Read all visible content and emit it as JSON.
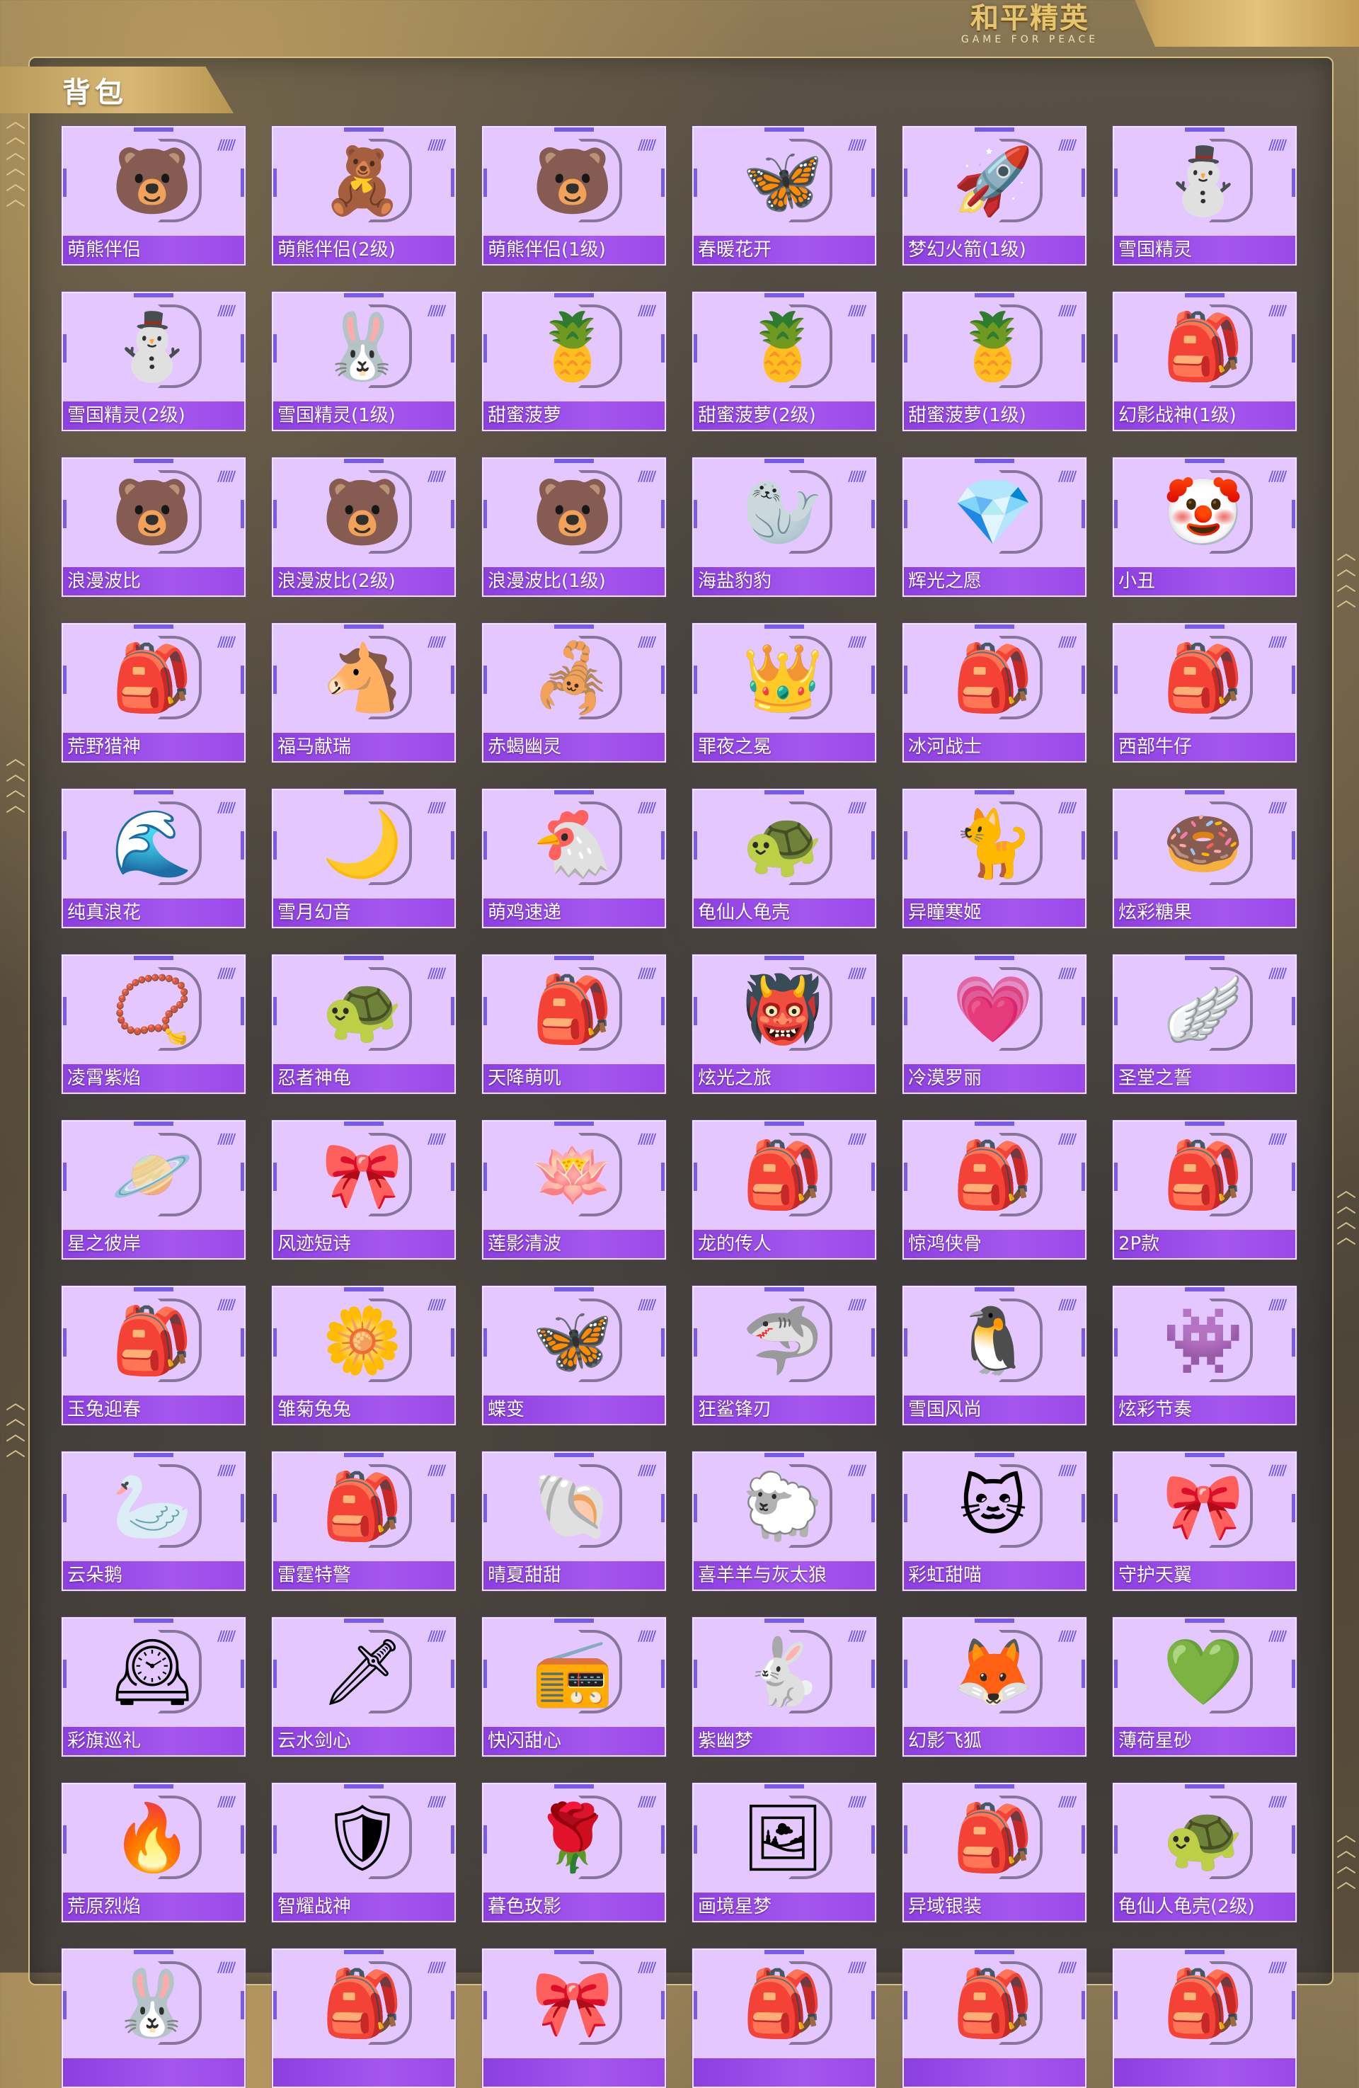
{
  "header": {
    "logo_cn": "和平精英",
    "logo_en": "GAME FOR PEACE"
  },
  "section": {
    "title": "背包"
  },
  "items": [
    {
      "name": "萌熊伴侣",
      "icon": "pink-bear-backpack-icon",
      "glyph": "🐻",
      "color": "#f3a2c6"
    },
    {
      "name": "萌熊伴侣(2级)",
      "icon": "pink-bear-backpack-icon",
      "glyph": "🧸",
      "color": "#f6a4bf"
    },
    {
      "name": "萌熊伴侣(1级)",
      "icon": "pink-bear-backpack-icon",
      "glyph": "🐻",
      "color": "#f4b0c8"
    },
    {
      "name": "春暖花开",
      "icon": "butterfly-backpack-icon",
      "glyph": "🦋",
      "color": "#7fd2f0"
    },
    {
      "name": "梦幻火箭(1级)",
      "icon": "rocket-backpack-icon",
      "glyph": "🚀",
      "color": "#3b3560"
    },
    {
      "name": "雪国精灵",
      "icon": "snowman-backpack-icon",
      "glyph": "⛄",
      "color": "#ffffff"
    },
    {
      "name": "雪国精灵(2级)",
      "icon": "snowman-backpack-icon",
      "glyph": "⛄",
      "color": "#ffffff"
    },
    {
      "name": "雪国精灵(1级)",
      "icon": "snow-bunny-backpack-icon",
      "glyph": "🐰",
      "color": "#ffffff"
    },
    {
      "name": "甜蜜菠萝",
      "icon": "pineapple-backpack-icon",
      "glyph": "🍍",
      "color": "#f5cf2e"
    },
    {
      "name": "甜蜜菠萝(2级)",
      "icon": "pineapple-backpack-icon",
      "glyph": "🍍",
      "color": "#f2c52a"
    },
    {
      "name": "甜蜜菠萝(1级)",
      "icon": "pineapple-backpack-icon",
      "glyph": "🍍",
      "color": "#f1c02a"
    },
    {
      "name": "幻影战神(1级)",
      "icon": "tactical-backpack-icon",
      "glyph": "🎒",
      "color": "#454f6a"
    },
    {
      "name": "浪漫波比",
      "icon": "bear-backpack-icon",
      "glyph": "🐻",
      "color": "#a57a45"
    },
    {
      "name": "浪漫波比(2级)",
      "icon": "bear-backpack-icon",
      "glyph": "🐻",
      "color": "#b18650"
    },
    {
      "name": "浪漫波比(1级)",
      "icon": "bear-backpack-icon",
      "glyph": "🐻",
      "color": "#b8894e"
    },
    {
      "name": "海盐豹豹",
      "icon": "seal-backpack-icon",
      "glyph": "🦭",
      "color": "#bfe9f5"
    },
    {
      "name": "辉光之愿",
      "icon": "crystal-heart-backpack-icon",
      "glyph": "💎",
      "color": "#c7c3d8"
    },
    {
      "name": "小丑",
      "icon": "jester-backpack-icon",
      "glyph": "🤡",
      "color": "#8e2fd0"
    },
    {
      "name": "荒野猎神",
      "icon": "hiking-backpack-icon",
      "glyph": "🎒",
      "color": "#4a3a33"
    },
    {
      "name": "福马献瑞",
      "icon": "horse-backpack-icon",
      "glyph": "🐴",
      "color": "#f07a3a"
    },
    {
      "name": "赤蝎幽灵",
      "icon": "scorpion-backpack-icon",
      "glyph": "🦂",
      "color": "#2f2a2e"
    },
    {
      "name": "罪夜之冕",
      "icon": "crown-backpack-icon",
      "glyph": "👑",
      "color": "#3a1f2f"
    },
    {
      "name": "冰河战士",
      "icon": "blue-backpack-icon",
      "glyph": "🎒",
      "color": "#3a6cc4"
    },
    {
      "name": "西部牛仔",
      "icon": "leather-backpack-icon",
      "glyph": "🎒",
      "color": "#8b4c2a"
    },
    {
      "name": "纯真浪花",
      "icon": "wave-backpack-icon",
      "glyph": "🌊",
      "color": "#5ac8e6"
    },
    {
      "name": "雪月幻音",
      "icon": "moon-backpack-icon",
      "glyph": "🌙",
      "color": "#cfd8e6"
    },
    {
      "name": "萌鸡速递",
      "icon": "chick-backpack-icon",
      "glyph": "🐔",
      "color": "#f4c84a"
    },
    {
      "name": "龟仙人龟壳",
      "icon": "turtle-shell-backpack-icon",
      "glyph": "🐢",
      "color": "#6f3bb4"
    },
    {
      "name": "异瞳寒姬",
      "icon": "cat-backpack-icon",
      "glyph": "🐈",
      "color": "#333a4a"
    },
    {
      "name": "炫彩糖果",
      "icon": "donut-backpack-icon",
      "glyph": "🍩",
      "color": "#f29ac0"
    },
    {
      "name": "凌霄紫焰",
      "icon": "amulet-backpack-icon",
      "glyph": "📿",
      "color": "#d8b6f2"
    },
    {
      "name": "忍者神龟",
      "icon": "ninja-turtle-backpack-icon",
      "glyph": "🐢",
      "color": "#2f7d5a"
    },
    {
      "name": "天降萌叽",
      "icon": "yellow-backpack-icon",
      "glyph": "🎒",
      "color": "#f6b63a"
    },
    {
      "name": "炫光之旅",
      "icon": "monster-backpack-icon",
      "glyph": "👹",
      "color": "#e6473a"
    },
    {
      "name": "冷漠罗丽",
      "icon": "heart-backpack-icon",
      "glyph": "💗",
      "color": "#f0a9d2"
    },
    {
      "name": "圣堂之誓",
      "icon": "angel-wing-backpack-icon",
      "glyph": "🪽",
      "color": "#f2ecf6"
    },
    {
      "name": "星之彼岸",
      "icon": "space-helmet-backpack-icon",
      "glyph": "🪐",
      "color": "#2b2f5a"
    },
    {
      "name": "风迹短诗",
      "icon": "ribbon-backpack-icon",
      "glyph": "🎀",
      "color": "#d8eaf6"
    },
    {
      "name": "莲影清波",
      "icon": "lotus-backpack-icon",
      "glyph": "🪷",
      "color": "#f0efe2"
    },
    {
      "name": "龙的传人",
      "icon": "red-backpack-icon",
      "glyph": "🎒",
      "color": "#c7322d"
    },
    {
      "name": "惊鸿侠骨",
      "icon": "black-backpack-icon",
      "glyph": "🎒",
      "color": "#222025"
    },
    {
      "name": "2P款",
      "icon": "white-backpack-icon",
      "glyph": "🎒",
      "color": "#f0f0f2"
    },
    {
      "name": "玉兔迎春",
      "icon": "rabbit-new-year-backpack-icon",
      "glyph": "🎒",
      "color": "#d8403a"
    },
    {
      "name": "雏菊兔兔",
      "icon": "daisy-bunny-backpack-icon",
      "glyph": "🌼",
      "color": "#dfe8cf"
    },
    {
      "name": "蝶变",
      "icon": "butterfly-black-backpack-icon",
      "glyph": "🦋",
      "color": "#1f1f26"
    },
    {
      "name": "狂鲨锋刃",
      "icon": "shark-backpack-icon",
      "glyph": "🦈",
      "color": "#2c2c33"
    },
    {
      "name": "雪国风尚",
      "icon": "penguin-backpack-icon",
      "glyph": "🐧",
      "color": "#f3f1ff"
    },
    {
      "name": "炫彩节奏",
      "icon": "purple-monster-backpack-icon",
      "glyph": "👾",
      "color": "#6a4cd6"
    },
    {
      "name": "云朵鹅",
      "icon": "goose-backpack-icon",
      "glyph": "🦢",
      "color": "#f7e07a"
    },
    {
      "name": "雷霆特警",
      "icon": "swat-backpack-icon",
      "glyph": "🎒",
      "color": "#6a5647"
    },
    {
      "name": "晴夏甜甜",
      "icon": "seashell-bunny-backpack-icon",
      "glyph": "🐚",
      "color": "#f6b2c6"
    },
    {
      "name": "喜羊羊与灰太狼",
      "icon": "sheep-backpack-icon",
      "glyph": "🐑",
      "color": "#f5f0ea"
    },
    {
      "name": "彩虹甜喵",
      "icon": "rainbow-cat-backpack-icon",
      "glyph": "🐱",
      "color": "#f4c6d8"
    },
    {
      "name": "守护天翼",
      "icon": "pink-wing-backpack-icon",
      "glyph": "🎀",
      "color": "#e98bb4"
    },
    {
      "name": "彩旗巡礼",
      "icon": "clock-backpack-icon",
      "glyph": "🕰",
      "color": "#f3d6e4"
    },
    {
      "name": "云水剑心",
      "icon": "sword-backpack-icon",
      "glyph": "🗡",
      "color": "#9bb2c3"
    },
    {
      "name": "快闪甜心",
      "icon": "boombox-backpack-icon",
      "glyph": "📻",
      "color": "#2e2a30"
    },
    {
      "name": "紫幽梦",
      "icon": "purple-bunny-backpack-icon",
      "glyph": "🐇",
      "color": "#9a86e6"
    },
    {
      "name": "幻影飞狐",
      "icon": "fox-backpack-icon",
      "glyph": "🦊",
      "color": "#2a2a33"
    },
    {
      "name": "薄荷星砂",
      "icon": "mint-heart-backpack-icon",
      "glyph": "💚",
      "color": "#bfeed6"
    },
    {
      "name": "荒原烈焰",
      "icon": "flame-backpack-icon",
      "glyph": "🔥",
      "color": "#b8302a"
    },
    {
      "name": "智耀战神",
      "icon": "armor-backpack-icon",
      "glyph": "🛡",
      "color": "#f1e6f6"
    },
    {
      "name": "暮色玫影",
      "icon": "doll-backpack-icon",
      "glyph": "🌹",
      "color": "#f5efe8"
    },
    {
      "name": "画境星梦",
      "icon": "picture-frame-backpack-icon",
      "glyph": "🖼",
      "color": "#c79a3a"
    },
    {
      "name": "异域银装",
      "icon": "mech-backpack-icon",
      "glyph": "🎒",
      "color": "#3a4a52"
    },
    {
      "name": "龟仙人龟壳(2级)",
      "icon": "turtle-shell-backpack-icon",
      "glyph": "🐢",
      "color": "#6b34c4"
    },
    {
      "name": "",
      "icon": "bunny-backpack-icon",
      "glyph": "🐰",
      "color": "#e8d2ff"
    },
    {
      "name": "",
      "icon": "black-backpack-icon",
      "glyph": "🎒",
      "color": "#2a2a30"
    },
    {
      "name": "",
      "icon": "pink-backpack-icon",
      "glyph": "🎀",
      "color": "#f2a8c8"
    },
    {
      "name": "",
      "icon": "galaxy-backpack-icon",
      "glyph": "🎒",
      "color": "#5e7be4"
    },
    {
      "name": "",
      "icon": "strap-backpack-icon",
      "glyph": "🎒",
      "color": "#3b3548"
    },
    {
      "name": "",
      "icon": "gold-backpack-icon",
      "glyph": "🎒",
      "color": "#e2b85a"
    }
  ]
}
